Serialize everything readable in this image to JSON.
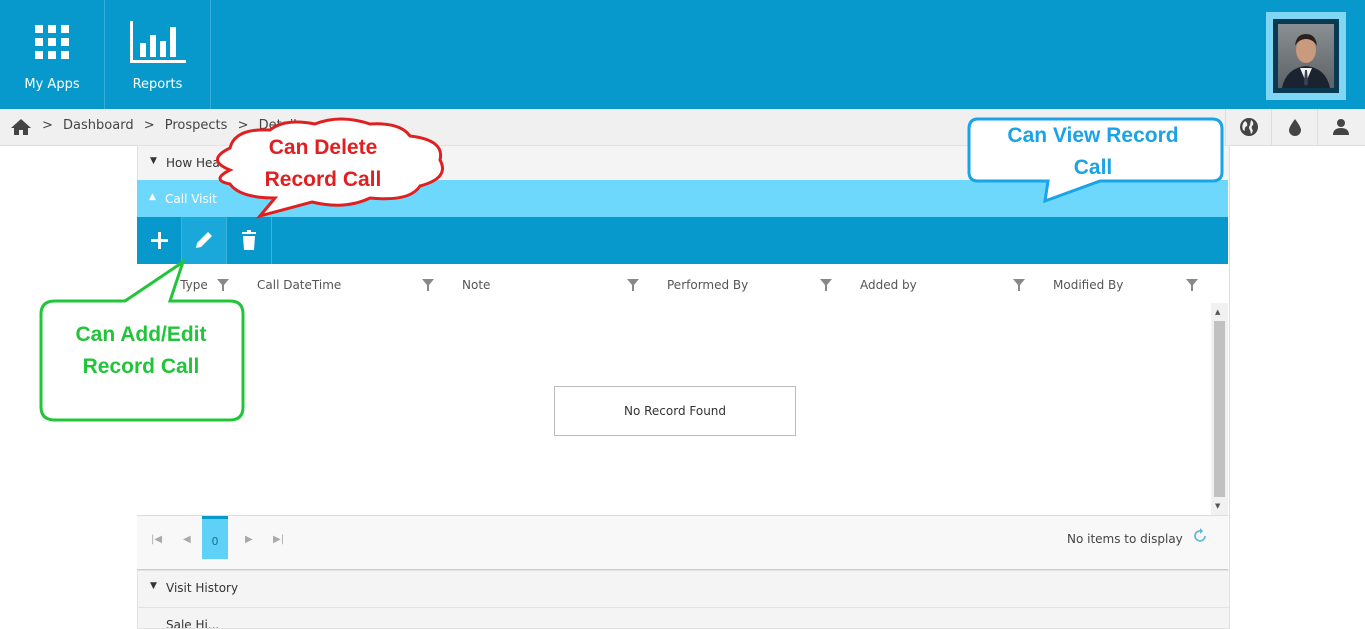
{
  "topnav": {
    "apps_label": "My Apps",
    "reports_label": "Reports"
  },
  "breadcrumb": {
    "items": [
      "Dashboard",
      "Prospects",
      "Detail"
    ],
    "separator": ">"
  },
  "sections": {
    "how_heard": "How Heard About Us",
    "call_visit": "Call Visit",
    "visit_history": "Visit History",
    "partial_next": "Sale Hi..."
  },
  "grid": {
    "columns": [
      "Call Type",
      "Call DateTime",
      "Note",
      "Performed By",
      "Added by",
      "Modified By"
    ],
    "empty_text": "No Record Found"
  },
  "pager": {
    "current_page": "0",
    "status": "No items to display"
  },
  "callouts": {
    "delete": {
      "line1": "Can Delete",
      "line2": "Record Call",
      "color": "#e02020"
    },
    "view": {
      "line1": "Can View Record",
      "line2": "Call",
      "color": "#1aa3e8"
    },
    "add_edit": {
      "line1": "Can Add/Edit",
      "line2": "Record Call",
      "color": "#22c43a"
    }
  },
  "colors": {
    "header_blue": "#0899cc",
    "section_active": "#6dd8fb"
  }
}
